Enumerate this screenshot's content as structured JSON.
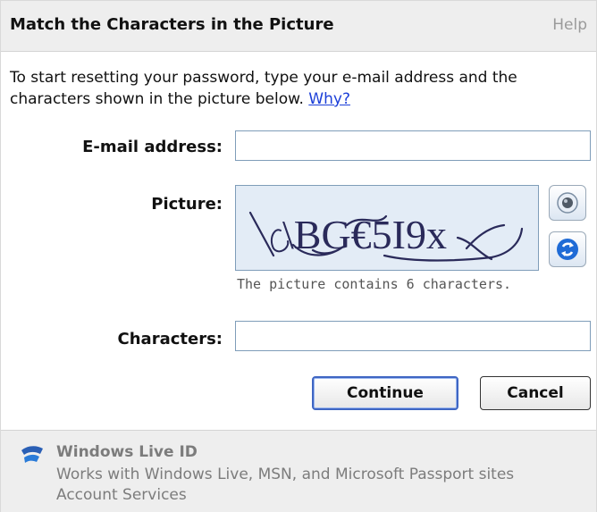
{
  "header": {
    "title": "Match the Characters in the Picture",
    "help_label": "Help"
  },
  "intro": {
    "text": "To start resetting your password, type your e-mail address and the characters shown in the picture below.",
    "why_link": "Why?"
  },
  "form": {
    "email_label": "E-mail address:",
    "email_value": "",
    "picture_label": "Picture:",
    "captcha_text": "\\BG€5I9x",
    "picture_caption": "The picture contains 6 characters.",
    "characters_label": "Characters:",
    "characters_value": ""
  },
  "actions": {
    "continue_label": "Continue",
    "cancel_label": "Cancel"
  },
  "footer": {
    "brand": "Windows Live ID",
    "tagline": "Works with Windows Live, MSN, and Microsoft Passport sites",
    "account_link": "Account Services"
  },
  "icons": {
    "audio": "speaker-icon",
    "refresh": "refresh-icon",
    "logo": "windows-live-logo-icon"
  },
  "colors": {
    "link": "#1c3fd8",
    "button_border": "#3f66c3",
    "captcha_bg": "#e3ecf6",
    "muted_text": "#7c7c7c"
  }
}
